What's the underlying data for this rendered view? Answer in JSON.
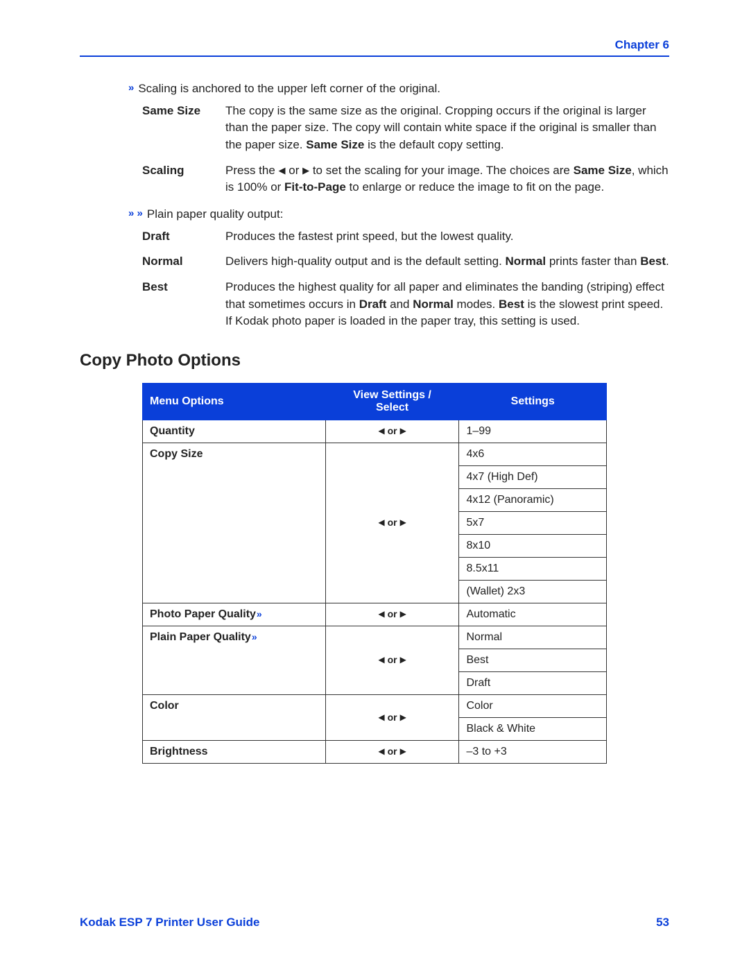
{
  "header": {
    "chapter": "Chapter 6"
  },
  "notes": {
    "scaling_note": "Scaling is anchored to the upper left corner of the original.",
    "plain_note": "Plain paper quality output:"
  },
  "defs1": {
    "same_size": {
      "term": "Same Size",
      "pre": "The copy is the same size as the original. Cropping occurs if the original is larger than the paper size. The copy will contain white space if the original is smaller than the paper size. ",
      "bold": "Same Size",
      "post": " is the default copy setting."
    },
    "scaling": {
      "term": "Scaling",
      "pre": "Press the ",
      "mid": " to set the scaling for your image. The choices are ",
      "b1": "Same Size",
      "post1": ", which is 100% or ",
      "b2": "Fit-to-Page",
      "post2": " to enlarge or reduce the image to fit on the page."
    }
  },
  "defs2": {
    "draft": {
      "term": "Draft",
      "desc": "Produces the fastest print speed, but the lowest quality."
    },
    "normal": {
      "term": "Normal",
      "pre": "Delivers high-quality output and is the default setting. ",
      "b1": "Normal",
      "mid": " prints faster than ",
      "b2": "Best",
      "post": "."
    },
    "best": {
      "term": "Best",
      "pre": "Produces the highest quality for all paper and eliminates the banding (striping) effect that sometimes occurs in ",
      "b1": "Draft",
      "mid1": " and ",
      "b2": "Normal",
      "mid2": " modes. ",
      "b3": "Best",
      "post": " is the slowest print speed. If Kodak photo paper is loaded in the paper tray, this setting is used."
    }
  },
  "section_title": "Copy Photo Options",
  "table": {
    "headers": [
      "Menu Options",
      "View Settings / Select",
      "Settings"
    ],
    "or": "or",
    "rows": [
      {
        "label": "Quantity",
        "settings": [
          "1–99"
        ]
      },
      {
        "label": "Copy Size",
        "settings": [
          "4x6",
          "4x7 (High Def)",
          "4x12 (Panoramic)",
          "5x7",
          "8x10",
          "8.5x11",
          "(Wallet) 2x3"
        ]
      },
      {
        "label": "Photo Paper Quality",
        "marker": true,
        "settings": [
          "Automatic"
        ]
      },
      {
        "label": "Plain Paper Quality",
        "marker": true,
        "settings": [
          "Normal",
          "Best",
          "Draft"
        ]
      },
      {
        "label": "Color",
        "settings": [
          "Color",
          "Black & White"
        ]
      },
      {
        "label": "Brightness",
        "settings": [
          "–3 to +3"
        ]
      }
    ]
  },
  "footer": {
    "left": "Kodak ESP 7 Printer User Guide",
    "right": "53"
  }
}
